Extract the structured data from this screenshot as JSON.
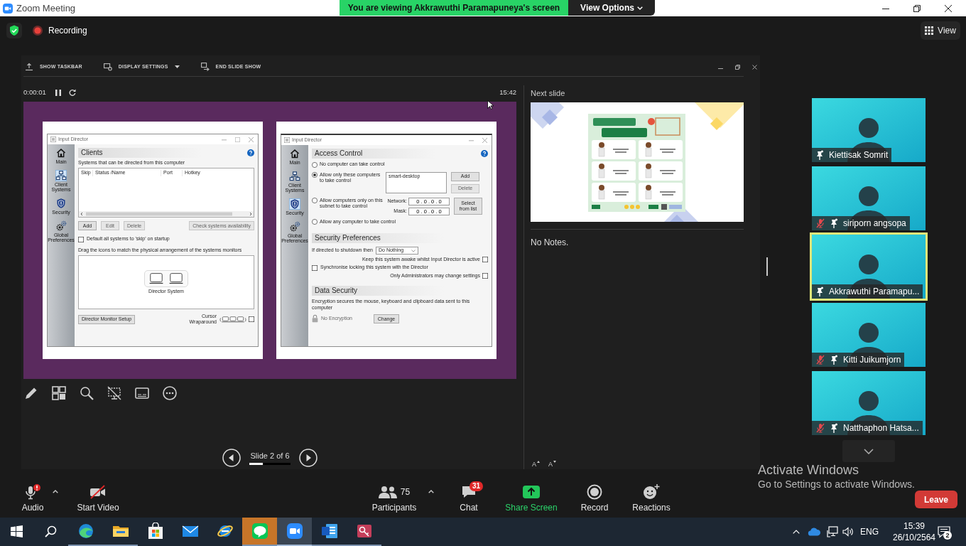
{
  "window": {
    "title": "Zoom Meeting"
  },
  "share_banner": {
    "message": "You are viewing Akkrawuthi Paramapuneya's screen",
    "options": "View Options"
  },
  "meeting_header": {
    "recording": "Recording",
    "view": "View"
  },
  "presenter": {
    "toolbar": [
      {
        "kind": "taskbar",
        "label": "SHOW TASKBAR"
      },
      {
        "kind": "display",
        "label": "DISPLAY SETTINGS"
      },
      {
        "kind": "end",
        "label": "END SLIDE SHOW"
      }
    ],
    "timer": "0:00:01",
    "clock": "15:42",
    "slide_windows": [
      {
        "kind": "clients",
        "title": "Input Director",
        "maximize": true,
        "nav": [
          {
            "kind": "home",
            "label": "Main",
            "selected": false
          },
          {
            "kind": "network",
            "label": "Client Systems",
            "selected": true
          },
          {
            "kind": "security",
            "label": "Security",
            "selected": false
          },
          {
            "kind": "preferences",
            "label": "Global Preferences",
            "selected": false
          }
        ],
        "heading": "Clients",
        "caption": "Systems that can be directed from this computer",
        "columns": [
          "Skip",
          "Status /Name",
          "Port",
          "Hotkey"
        ],
        "buttons": [
          {
            "label": "Add",
            "disabled": false
          },
          {
            "label": "Edit",
            "disabled": true
          },
          {
            "label": "Delete",
            "disabled": true
          },
          {
            "label": "Check systems availability",
            "disabled": true
          }
        ],
        "skip_option": {
          "label": "Default all systems to 'skip' on startup",
          "checked": false
        },
        "arrangement_caption": "Drag the icons to match the physical arrangement of the systems monitors",
        "system_label": "Director System",
        "setup_button": "Director Monitor Setup",
        "wraparound": {
          "label": "Cursor Wraparound",
          "checked": false
        }
      },
      {
        "kind": "access_control",
        "title": "Input Director",
        "maximize": false,
        "nav": [
          {
            "kind": "home",
            "label": "Main",
            "selected": false
          },
          {
            "kind": "network",
            "label": "Client Systems",
            "selected": false
          },
          {
            "kind": "security",
            "label": "Security",
            "selected": true
          },
          {
            "kind": "preferences",
            "label": "Global Preferences",
            "selected": false
          }
        ],
        "heading": "Access Control",
        "options": [
          {
            "label": "No computer can take control",
            "selected": false
          },
          {
            "label": "Allow only these computers to take control",
            "selected": true
          },
          {
            "label": "Allow computers only on this subnet to take control",
            "selected": false
          },
          {
            "label": "Allow any computer to take control",
            "selected": false
          }
        ],
        "allowed": [
          "smart-desktop"
        ],
        "list_buttons": [
          {
            "label": "Add",
            "disabled": false
          },
          {
            "label": "Delete",
            "disabled": true
          }
        ],
        "network_label": "Network:",
        "network": "0 . 0 . 0 . 0",
        "mask_label": "Mask:",
        "mask": "0 . 0 . 0 . 0",
        "select_button": "Select from list",
        "prefs_heading": "Security Preferences",
        "shutdown_label": "If directed to shutdown then",
        "shutdown_value": "Do Nothing",
        "checks": [
          {
            "label": "Keep this system awake whilst Input Director is active",
            "checked": false
          },
          {
            "label": "Synchronise locking this system with the Director",
            "checked": false
          },
          {
            "label": "Only Administrators may change settings",
            "checked": false
          }
        ],
        "data_heading": "Data Security",
        "data_text": "Encryption secures the mouse, keyboard and clipboard data sent to this computer",
        "encryption": "No Encryption",
        "change_button": "Change"
      }
    ],
    "nav": {
      "label": "Slide 2 of 6",
      "level": 0.33
    },
    "next_slide": "Next slide",
    "notes": "No Notes.",
    "font_buttons": [
      {
        "kind": "increase",
        "label": "A"
      },
      {
        "kind": "decrease",
        "label": "A"
      }
    ]
  },
  "participants": [
    {
      "name": "Kiettisak Somrit",
      "muted": false,
      "speaking": false
    },
    {
      "name": "siriporn angsopa",
      "muted": true,
      "speaking": false
    },
    {
      "name": "Akkrawuthi Paramapu...",
      "muted": false,
      "speaking": true
    },
    {
      "name": "Kitti Juikumjorn",
      "muted": true,
      "speaking": false
    },
    {
      "name": "Natthaphon Hatsa...",
      "muted": true,
      "speaking": false
    }
  ],
  "toolbar": [
    {
      "kind": "audio",
      "label": "Audio",
      "alert": true
    },
    {
      "kind": "video",
      "label": "Start Video",
      "on": false
    },
    {
      "kind": "participants",
      "label": "Participants",
      "count": "75"
    },
    {
      "kind": "chat",
      "label": "Chat",
      "badge": "31"
    },
    {
      "kind": "share",
      "label": "Share Screen"
    },
    {
      "kind": "record",
      "label": "Record"
    },
    {
      "kind": "reactions",
      "label": "Reactions"
    }
  ],
  "leave": "Leave",
  "activation": {
    "title": "Activate Windows",
    "text": "Go to Settings to activate Windows."
  },
  "taskbar": {
    "apps": [
      {
        "kind": "edge",
        "running": true,
        "selected": false,
        "attention": false
      },
      {
        "kind": "explorer",
        "running": true,
        "selected": false,
        "attention": false
      },
      {
        "kind": "store",
        "running": false,
        "selected": false,
        "attention": false
      },
      {
        "kind": "mail",
        "running": false,
        "selected": false,
        "attention": false
      },
      {
        "kind": "ie",
        "running": false,
        "selected": false,
        "attention": false
      },
      {
        "kind": "line",
        "running": true,
        "selected": false,
        "attention": true
      },
      {
        "kind": "zoom",
        "running": true,
        "selected": true,
        "attention": false
      },
      {
        "kind": "word",
        "running": true,
        "selected": false,
        "attention": false
      },
      {
        "kind": "access",
        "running": true,
        "selected": false,
        "attention": false
      }
    ],
    "language": "ENG",
    "time": "15:39",
    "date": "26/10/2564",
    "notifications": "2"
  }
}
